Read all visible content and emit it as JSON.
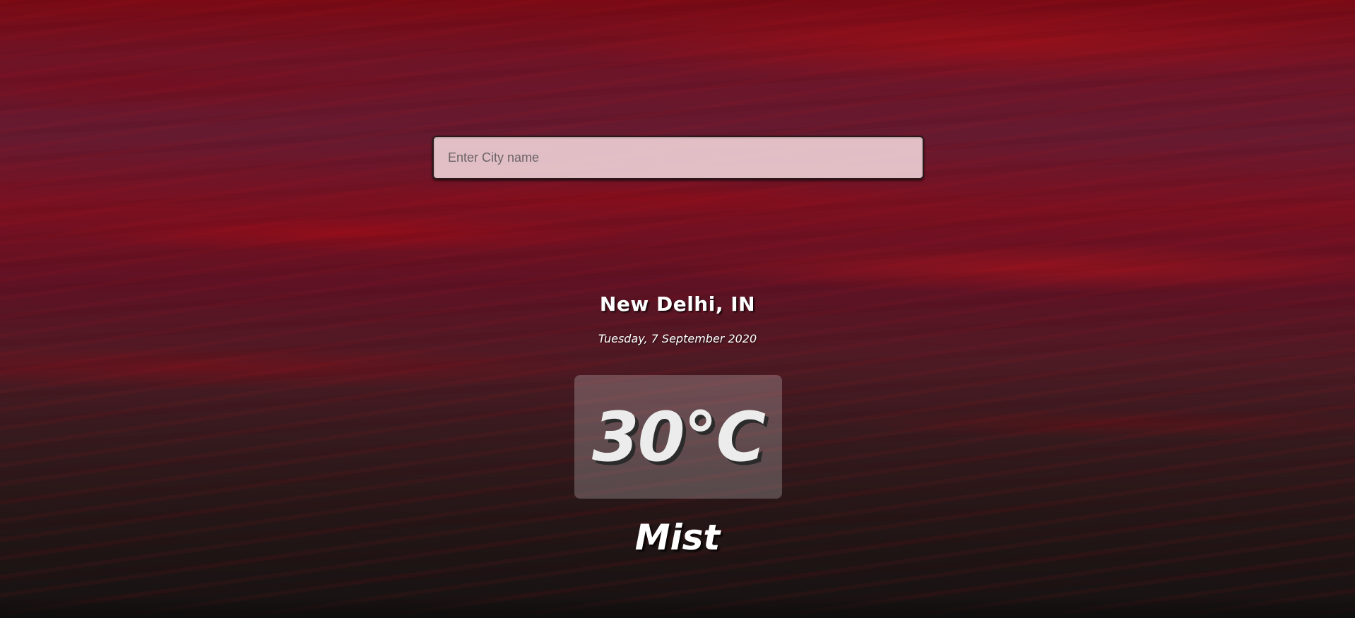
{
  "search": {
    "placeholder": "Enter City name",
    "value": ""
  },
  "weather": {
    "location": "New Delhi, IN",
    "date": "Tuesday, 7 September 2020",
    "temperature": "30°C",
    "condition": "Mist"
  },
  "colors": {
    "background_top": "#7a0a14",
    "background_bottom": "#161212",
    "input_background": "#ebcdd2",
    "text": "#ffffff"
  }
}
